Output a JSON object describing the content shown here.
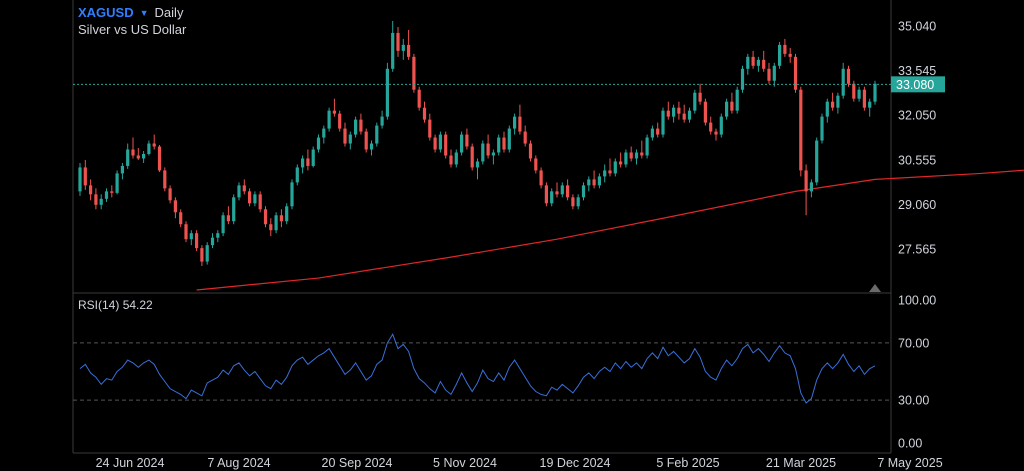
{
  "header": {
    "symbol": "XAGUSD",
    "caret_icon": "triangle-down-icon",
    "interval": "Daily",
    "description": "Silver vs US Dollar"
  },
  "colors": {
    "up": "#26a69a",
    "down": "#ef5350",
    "ma": "#e0272a",
    "rsi": "#3a6fd8",
    "last_price_bg": "#26a69a",
    "grid_dash": "#555555"
  },
  "chart_data": [
    {
      "type": "candlestick",
      "symbol": "XAGUSD",
      "interval": "Daily",
      "y_ticks": [
        "35.040",
        "33.545",
        "32.050",
        "30.555",
        "29.060",
        "27.565"
      ],
      "ylim": [
        26.2,
        35.5
      ],
      "last_price": "33.080",
      "x_ticks": [
        "24 Jun 2024",
        "7 Aug 2024",
        "20 Sep 2024",
        "5 Nov 2024",
        "19 Dec 2024",
        "5 Feb 2025",
        "21 Mar 2025",
        "7 May 2025"
      ],
      "candles": [
        [
          29.5,
          30.45,
          29.35,
          30.3
        ],
        [
          30.3,
          30.55,
          29.55,
          29.7
        ],
        [
          29.7,
          29.9,
          29.2,
          29.4
        ],
        [
          29.4,
          29.6,
          28.9,
          29.05
        ],
        [
          29.05,
          29.4,
          28.9,
          29.25
        ],
        [
          29.25,
          29.6,
          29.15,
          29.5
        ],
        [
          29.5,
          29.7,
          29.3,
          29.45
        ],
        [
          29.45,
          30.2,
          29.4,
          30.1
        ],
        [
          30.1,
          30.45,
          29.9,
          30.35
        ],
        [
          30.35,
          31.1,
          30.25,
          30.9
        ],
        [
          30.9,
          31.3,
          30.6,
          30.7
        ],
        [
          30.7,
          30.95,
          30.55,
          30.6
        ],
        [
          30.6,
          30.85,
          30.45,
          30.75
        ],
        [
          30.75,
          31.2,
          30.7,
          31.1
        ],
        [
          31.1,
          31.4,
          30.9,
          31.0
        ],
        [
          31.0,
          31.05,
          30.15,
          30.2
        ],
        [
          30.2,
          30.3,
          29.5,
          29.6
        ],
        [
          29.6,
          29.7,
          29.1,
          29.2
        ],
        [
          29.2,
          29.3,
          28.6,
          28.8
        ],
        [
          28.8,
          28.9,
          28.3,
          28.4
        ],
        [
          28.4,
          28.5,
          27.8,
          27.9
        ],
        [
          27.9,
          28.2,
          27.7,
          28.1
        ],
        [
          28.1,
          28.2,
          27.5,
          27.6
        ],
        [
          27.6,
          27.7,
          27.0,
          27.15
        ],
        [
          27.15,
          27.8,
          27.05,
          27.7
        ],
        [
          27.7,
          28.1,
          27.6,
          27.95
        ],
        [
          27.95,
          28.2,
          27.8,
          28.1
        ],
        [
          28.1,
          28.8,
          28.0,
          28.7
        ],
        [
          28.7,
          29.0,
          28.4,
          28.5
        ],
        [
          28.5,
          29.4,
          28.4,
          29.3
        ],
        [
          29.3,
          29.8,
          29.2,
          29.7
        ],
        [
          29.7,
          29.9,
          29.4,
          29.5
        ],
        [
          29.5,
          29.6,
          29.0,
          29.1
        ],
        [
          29.1,
          29.5,
          29.0,
          29.4
        ],
        [
          29.4,
          29.5,
          28.8,
          28.9
        ],
        [
          28.9,
          29.0,
          28.3,
          28.4
        ],
        [
          28.4,
          28.6,
          28.0,
          28.2
        ],
        [
          28.2,
          28.8,
          28.1,
          28.7
        ],
        [
          28.7,
          28.9,
          28.3,
          28.5
        ],
        [
          28.5,
          29.1,
          28.4,
          29.0
        ],
        [
          29.0,
          29.9,
          28.9,
          29.8
        ],
        [
          29.8,
          30.4,
          29.7,
          30.3
        ],
        [
          30.3,
          30.7,
          30.1,
          30.6
        ],
        [
          30.6,
          30.9,
          30.2,
          30.35
        ],
        [
          30.35,
          31.0,
          30.3,
          30.9
        ],
        [
          30.9,
          31.4,
          30.8,
          31.3
        ],
        [
          31.3,
          31.7,
          31.1,
          31.6
        ],
        [
          31.6,
          32.3,
          31.5,
          32.2
        ],
        [
          32.2,
          32.6,
          32.0,
          32.1
        ],
        [
          32.1,
          32.2,
          31.5,
          31.6
        ],
        [
          31.6,
          31.8,
          31.0,
          31.1
        ],
        [
          31.1,
          31.5,
          30.9,
          31.4
        ],
        [
          31.4,
          32.0,
          31.3,
          31.9
        ],
        [
          31.9,
          32.1,
          31.4,
          31.5
        ],
        [
          31.5,
          31.6,
          30.8,
          30.9
        ],
        [
          30.9,
          31.2,
          30.7,
          31.1
        ],
        [
          31.1,
          31.8,
          31.0,
          31.7
        ],
        [
          31.7,
          32.2,
          31.6,
          32.0
        ],
        [
          32.0,
          33.8,
          31.9,
          33.6
        ],
        [
          33.6,
          35.2,
          33.5,
          34.8
        ],
        [
          34.8,
          35.0,
          34.0,
          34.2
        ],
        [
          34.2,
          34.6,
          33.9,
          34.4
        ],
        [
          34.4,
          34.9,
          33.9,
          34.0
        ],
        [
          34.0,
          34.1,
          32.8,
          32.9
        ],
        [
          32.9,
          33.0,
          32.2,
          32.3
        ],
        [
          32.3,
          32.5,
          31.8,
          31.9
        ],
        [
          31.9,
          32.1,
          31.2,
          31.3
        ],
        [
          31.3,
          31.4,
          30.8,
          30.9
        ],
        [
          30.9,
          31.5,
          30.8,
          31.4
        ],
        [
          31.4,
          31.5,
          30.6,
          30.7
        ],
        [
          30.7,
          30.9,
          30.3,
          30.4
        ],
        [
          30.4,
          30.9,
          30.3,
          30.8
        ],
        [
          30.8,
          31.5,
          30.7,
          31.4
        ],
        [
          31.4,
          31.6,
          30.9,
          31.0
        ],
        [
          31.0,
          31.1,
          30.2,
          30.3
        ],
        [
          30.3,
          30.6,
          29.9,
          30.5
        ],
        [
          30.5,
          31.2,
          30.4,
          31.1
        ],
        [
          31.1,
          31.4,
          30.6,
          30.7
        ],
        [
          30.7,
          30.9,
          30.4,
          30.8
        ],
        [
          30.8,
          31.4,
          30.7,
          31.3
        ],
        [
          31.3,
          31.5,
          30.8,
          30.9
        ],
        [
          30.9,
          31.7,
          30.8,
          31.6
        ],
        [
          31.6,
          32.1,
          31.4,
          32.0
        ],
        [
          32.0,
          32.4,
          31.4,
          31.5
        ],
        [
          31.5,
          31.7,
          31.0,
          31.1
        ],
        [
          31.1,
          31.2,
          30.5,
          30.6
        ],
        [
          30.6,
          30.7,
          30.1,
          30.2
        ],
        [
          30.2,
          30.3,
          29.6,
          29.7
        ],
        [
          29.7,
          29.8,
          29.0,
          29.1
        ],
        [
          29.1,
          29.6,
          29.0,
          29.5
        ],
        [
          29.5,
          29.8,
          29.3,
          29.4
        ],
        [
          29.4,
          29.8,
          29.3,
          29.7
        ],
        [
          29.7,
          29.9,
          29.2,
          29.3
        ],
        [
          29.3,
          29.4,
          28.9,
          29.0
        ],
        [
          29.0,
          29.4,
          28.9,
          29.3
        ],
        [
          29.3,
          29.8,
          29.2,
          29.7
        ],
        [
          29.7,
          30.0,
          29.5,
          29.9
        ],
        [
          29.9,
          30.2,
          29.6,
          29.7
        ],
        [
          29.7,
          30.1,
          29.6,
          30.0
        ],
        [
          30.0,
          30.4,
          29.8,
          30.2
        ],
        [
          30.2,
          30.6,
          30.0,
          30.1
        ],
        [
          30.1,
          30.6,
          30.0,
          30.5
        ],
        [
          30.5,
          30.8,
          30.3,
          30.4
        ],
        [
          30.4,
          30.9,
          30.3,
          30.8
        ],
        [
          30.8,
          31.0,
          30.5,
          30.6
        ],
        [
          30.6,
          30.9,
          30.4,
          30.8
        ],
        [
          30.8,
          31.2,
          30.6,
          30.7
        ],
        [
          30.7,
          31.4,
          30.6,
          31.3
        ],
        [
          31.3,
          31.7,
          31.2,
          31.6
        ],
        [
          31.6,
          31.8,
          31.3,
          31.4
        ],
        [
          31.4,
          32.3,
          31.3,
          32.2
        ],
        [
          32.2,
          32.5,
          31.9,
          32.0
        ],
        [
          32.0,
          32.4,
          31.8,
          32.3
        ],
        [
          32.3,
          32.5,
          31.9,
          32.1
        ],
        [
          32.1,
          32.4,
          31.8,
          31.9
        ],
        [
          31.9,
          32.3,
          31.8,
          32.2
        ],
        [
          32.2,
          32.9,
          32.1,
          32.8
        ],
        [
          32.8,
          33.1,
          32.4,
          32.5
        ],
        [
          32.5,
          32.6,
          31.7,
          31.8
        ],
        [
          31.8,
          32.0,
          31.4,
          31.5
        ],
        [
          31.5,
          31.6,
          31.2,
          31.4
        ],
        [
          31.4,
          32.1,
          31.3,
          32.0
        ],
        [
          32.0,
          32.6,
          31.9,
          32.5
        ],
        [
          32.5,
          32.8,
          32.1,
          32.2
        ],
        [
          32.2,
          33.0,
          32.1,
          32.9
        ],
        [
          32.9,
          33.7,
          32.8,
          33.6
        ],
        [
          33.6,
          34.1,
          33.4,
          34.0
        ],
        [
          34.0,
          34.2,
          33.6,
          33.7
        ],
        [
          33.7,
          34.0,
          33.5,
          33.9
        ],
        [
          33.9,
          34.2,
          33.5,
          33.6
        ],
        [
          33.6,
          33.8,
          33.1,
          33.2
        ],
        [
          33.2,
          33.8,
          33.0,
          33.7
        ],
        [
          33.7,
          34.5,
          33.6,
          34.4
        ],
        [
          34.4,
          34.6,
          34.0,
          34.1
        ],
        [
          34.1,
          34.3,
          33.8,
          34.0
        ],
        [
          34.0,
          34.1,
          32.8,
          32.9
        ],
        [
          32.9,
          33.0,
          30.0,
          30.2
        ],
        [
          30.2,
          30.4,
          28.7,
          29.5
        ],
        [
          29.5,
          29.9,
          29.3,
          29.8
        ],
        [
          29.8,
          31.3,
          29.7,
          31.2
        ],
        [
          31.2,
          32.1,
          31.1,
          32.0
        ],
        [
          32.0,
          32.6,
          31.8,
          32.5
        ],
        [
          32.5,
          32.8,
          32.2,
          32.3
        ],
        [
          32.3,
          32.8,
          32.1,
          32.7
        ],
        [
          32.7,
          33.8,
          32.6,
          33.6
        ],
        [
          33.6,
          33.7,
          33.0,
          33.1
        ],
        [
          33.1,
          33.2,
          32.5,
          32.6
        ],
        [
          32.6,
          33.0,
          32.5,
          32.9
        ],
        [
          32.9,
          33.0,
          32.2,
          32.3
        ],
        [
          32.3,
          32.6,
          32.0,
          32.5
        ],
        [
          32.5,
          33.2,
          32.4,
          33.1
        ]
      ],
      "ma_line": [
        [
          22,
          26.2
        ],
        [
          45,
          26.6
        ],
        [
          70,
          27.3
        ],
        [
          90,
          27.9
        ],
        [
          110,
          28.6
        ],
        [
          135,
          29.5
        ],
        [
          150,
          29.9
        ],
        [
          170,
          30.1
        ],
        [
          185,
          30.3
        ],
        [
          200,
          30.5
        ],
        [
          215,
          30.6
        ],
        [
          230,
          30.75
        ],
        [
          250,
          30.9
        ],
        [
          265,
          31.0
        ]
      ]
    },
    {
      "type": "line",
      "name": "RSI(14)",
      "label": "RSI(14)",
      "value_text": "54.22",
      "y_ticks": [
        "100.00",
        "70.00",
        "30.00",
        "0.00"
      ],
      "ylim": [
        0,
        100
      ],
      "levels": [
        70,
        30
      ],
      "values": [
        52,
        55,
        49,
        46,
        41,
        45,
        44,
        50,
        53,
        58,
        56,
        53,
        56,
        58,
        55,
        48,
        43,
        38,
        36,
        34,
        31,
        37,
        35,
        33,
        42,
        44,
        46,
        51,
        48,
        54,
        56,
        51,
        47,
        50,
        45,
        40,
        38,
        44,
        41,
        46,
        54,
        58,
        60,
        55,
        58,
        61,
        63,
        66,
        60,
        54,
        48,
        51,
        56,
        50,
        44,
        47,
        55,
        58,
        70,
        76,
        66,
        69,
        64,
        52,
        45,
        42,
        38,
        35,
        43,
        37,
        34,
        41,
        49,
        42,
        36,
        42,
        51,
        45,
        43,
        49,
        44,
        53,
        58,
        52,
        46,
        40,
        36,
        34,
        33,
        39,
        37,
        41,
        38,
        35,
        40,
        46,
        49,
        45,
        50,
        53,
        50,
        56,
        52,
        57,
        53,
        56,
        52,
        59,
        63,
        59,
        67,
        61,
        64,
        60,
        56,
        59,
        66,
        60,
        50,
        46,
        44,
        52,
        58,
        54,
        59,
        66,
        69,
        63,
        66,
        62,
        57,
        63,
        68,
        63,
        61,
        52,
        35,
        28,
        31,
        44,
        52,
        56,
        52,
        56,
        62,
        55,
        50,
        54,
        48,
        52,
        54
      ]
    }
  ]
}
